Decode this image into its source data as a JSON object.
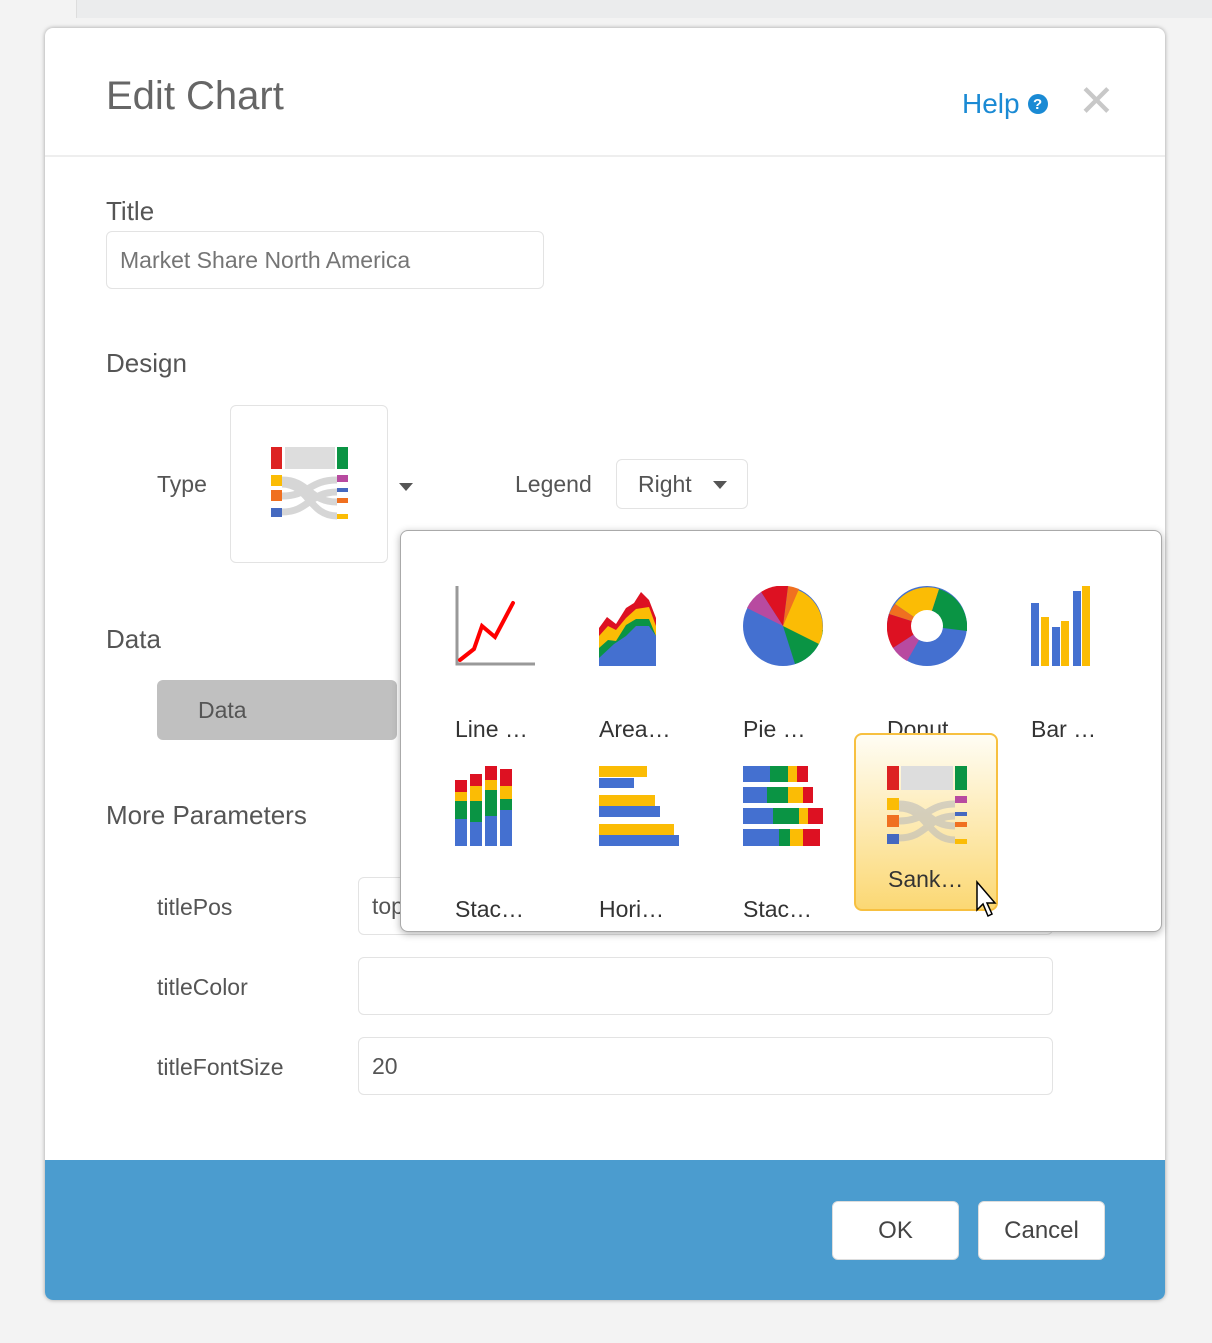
{
  "dialog": {
    "title": "Edit Chart",
    "help_label": "Help",
    "help_icon": "?",
    "close_icon": "✕"
  },
  "form": {
    "title_label": "Title",
    "title_placeholder": "Market Share North America",
    "design_label": "Design",
    "type_label": "Type",
    "legend_label": "Legend",
    "legend_value": "Right",
    "data_label": "Data",
    "data_button": "Data",
    "more_params_label": "More Parameters",
    "params": [
      {
        "name": "titlePos",
        "value": "top"
      },
      {
        "name": "titleColor",
        "value": ""
      },
      {
        "name": "titleFontSize",
        "value": "20"
      }
    ]
  },
  "chart_types": [
    {
      "label": "Line …",
      "icon": "line-chart-icon"
    },
    {
      "label": "Area…",
      "icon": "area-chart-icon"
    },
    {
      "label": "Pie …",
      "icon": "pie-chart-icon"
    },
    {
      "label": "Donut",
      "icon": "donut-chart-icon"
    },
    {
      "label": "Bar …",
      "icon": "bar-chart-icon"
    },
    {
      "label": "Stac…",
      "icon": "stacked-column-icon"
    },
    {
      "label": "Hori…",
      "icon": "horizontal-bar-icon"
    },
    {
      "label": "Stac…",
      "icon": "stacked-bar-icon"
    },
    {
      "label": "Sank…",
      "icon": "sankey-chart-icon",
      "selected": true
    }
  ],
  "footer": {
    "ok": "OK",
    "cancel": "Cancel"
  },
  "colors": {
    "accent": "#1a8ad4",
    "footer": "#4b9ccf",
    "selected": "#f7c040"
  }
}
